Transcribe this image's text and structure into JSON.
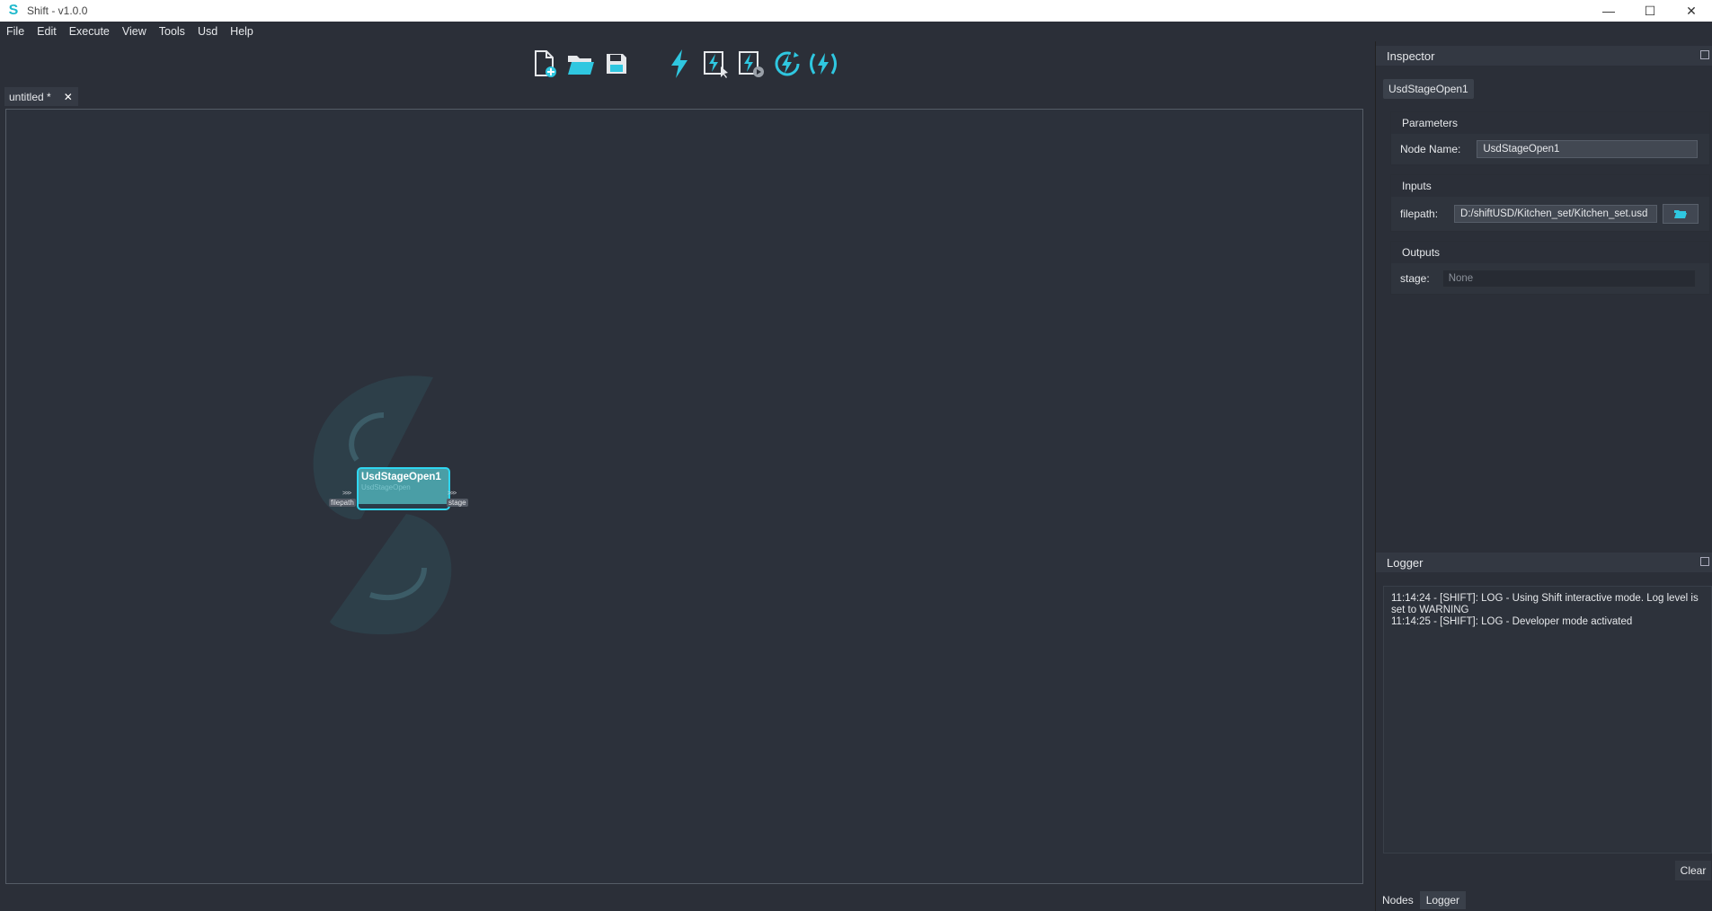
{
  "window": {
    "title": "Shift - v1.0.0",
    "controls": {
      "minimize": "—",
      "maximize": "☐",
      "close": "✕"
    }
  },
  "menu": [
    "File",
    "Edit",
    "Execute",
    "View",
    "Tools",
    "Usd",
    "Help"
  ],
  "toolbar": {
    "icons": [
      "new-file-icon",
      "open-folder-icon",
      "save-icon",
      "execute-icon",
      "execute-selected-icon",
      "execute-stepped-icon",
      "execute-refresh-icon",
      "execute-broadcast-icon"
    ],
    "accent": "#2fc7e0"
  },
  "tab": {
    "label": "untitled *",
    "close": "✕"
  },
  "graph": {
    "node": {
      "title": "UsdStageOpen1",
      "subtitle": "UsdStageOpen",
      "input_port": "filepath",
      "output_port": "stage",
      "port_marker": ">>>"
    }
  },
  "inspector": {
    "title": "Inspector",
    "selected": "UsdStageOpen1",
    "parameters": {
      "header": "Parameters",
      "node_name_label": "Node Name:",
      "node_name_value": "UsdStageOpen1"
    },
    "inputs": {
      "header": "Inputs",
      "filepath_label": "filepath:",
      "filepath_value": "D:/shiftUSD/Kitchen_set/Kitchen_set.usd"
    },
    "outputs": {
      "header": "Outputs",
      "stage_label": "stage:",
      "stage_value": "None"
    }
  },
  "logger": {
    "title": "Logger",
    "lines": [
      "11:14:24 - [SHIFT]: LOG - Using Shift interactive mode. Log level is set to WARNING",
      "11:14:25 - [SHIFT]: LOG - Developer mode activated"
    ],
    "clear_label": "Clear"
  },
  "bottom_tabs": [
    "Nodes",
    "Logger"
  ]
}
